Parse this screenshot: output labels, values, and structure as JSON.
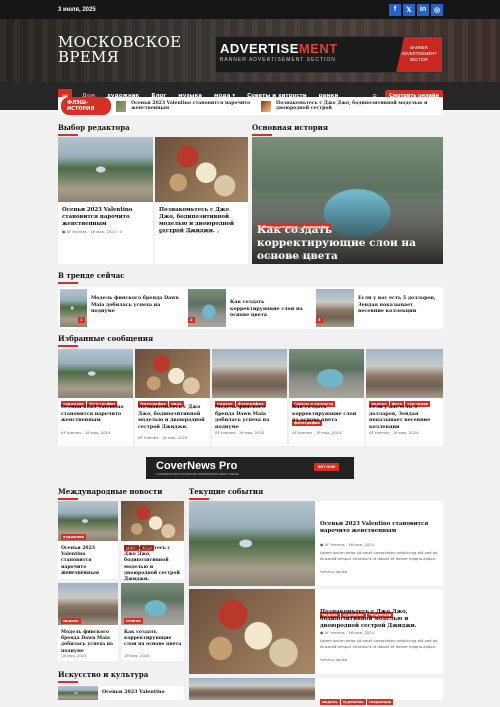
{
  "topbar": {
    "date": "3 июля, 2025",
    "social": [
      "f",
      "𝕏",
      "in",
      "◎"
    ]
  },
  "site": {
    "logo_line1": "МОСКОВСКОЕ",
    "logo_line2": "ВРЕМЯ"
  },
  "banner": {
    "ad_prefix": "ADVERTISE",
    "ad_suffix": "MENT",
    "sub": "BANNER ADVERTISEMENT SECTION",
    "tag_line1": "BANNER",
    "tag_line2": "ADVERTISEMENT",
    "tag_line3": "SECTION"
  },
  "nav": {
    "home_icon": "≡",
    "items": [
      "Дом",
      "художник",
      "Блог",
      "музыка",
      "мода",
      "Советы и хитрости",
      "рамки"
    ],
    "search_icon": "⌕",
    "watch": "Смотреть онлайн",
    "mode_chevron": "▾"
  },
  "ticker": {
    "label": "ФЛЭШ-ИСТОРИЯ",
    "item1": "Осеньи 2023 Valentino становится нарочито женственным",
    "item2": "Познакомьтесь с Джо Джо, бодипозитивной моделью и двоюродной сестрой"
  },
  "editor": {
    "title": "Выбор редактора",
    "c1": {
      "title": "Осеньи 2023 Valentino становится нарочито женственным",
      "author": "AF themes",
      "date": "16 мая, 2024",
      "comments": "0"
    },
    "c2": {
      "title": "Познакомьтесь с Джо Джо, бодипозитивной моделью и двоюродной сестрой Джиджи.",
      "author": "AF themes",
      "date": "16 мая, 2024",
      "comments": "0"
    }
  },
  "main_story": {
    "title": "Основная история",
    "badge1": "Советы и хитрости",
    "badge2": "фотография",
    "headline": "Как создать корректирующие слои на основе цвета",
    "author": "AF themes",
    "date": "16 мая, 2024",
    "comments": "0"
  },
  "trending": {
    "title": "В тренде сейчас",
    "items": [
      {
        "num": "1",
        "text": "Модель финского бренда Dawn Maia добилась успеха на подиуме"
      },
      {
        "num": "2",
        "text": "Как создать корректирующие слои на основе цвета"
      },
      {
        "num": "3",
        "text": "Если у вас есть 5 долларов, Зендая показывает весенние коллекции"
      }
    ]
  },
  "featured": {
    "title": "Избранные сообщения",
    "items": [
      {
        "badges": [
          "художник",
          "фотография"
        ],
        "text": "Осеньи 2023 Valentino становится нарочито женственным",
        "author": "AF themes",
        "date": "16 мая, 2024"
      },
      {
        "badges": [
          "фотография",
          "мода"
        ],
        "text": "Познакомьтесь с Джо Джо, бодипозитивной моделью и двоюродной сестрой Джиджи.",
        "author": "AF themes",
        "date": "16 мая, 2024"
      },
      {
        "badges": [
          "модель",
          "фотография"
        ],
        "text": "Модель финского бренда Dawn Maia добилась успеха на подиуме",
        "author": "AF themes",
        "date": "16 мая, 2024"
      },
      {
        "badges": [
          "Советы и хитрости",
          "фотография"
        ],
        "text": "Как создать корректирующие слои на основе цвета",
        "author": "AF themes",
        "date": "16 мая, 2024"
      },
      {
        "badges": [
          "модель",
          "фото",
          "художник"
        ],
        "text": "Если у вас есть 5 долларов, Зендая показывает весенние коллекции",
        "author": "AF themes",
        "date": "16 мая, 2024"
      }
    ]
  },
  "ad": {
    "brand": "CoverNews Pro",
    "sub": "A PREMIUM MULTIPURPOSE WORDPRESS NEWS THEME",
    "buy": "BUY NOW"
  },
  "international": {
    "title": "Международные новости",
    "items": [
      {
        "badges": [
          "художник"
        ],
        "text": "Осеньи 2023 Valentino становится нарочито женственным",
        "date": "16 мая, 2024"
      },
      {
        "badges": [
          "фото",
          "мода"
        ],
        "text": "Познакомьтесь с Джо Джо, бодипозитивной моделью и двоюродной сестрой Джиджи.",
        "date": "16 мая, 2024"
      },
      {
        "badges": [
          "модель"
        ],
        "text": "Модель финского бренда Dawn Maia добилась успеха на подиуме",
        "date": "16 мая, 2024"
      },
      {
        "badges": [
          "советы"
        ],
        "text": "Как создать корректирующие слои на основе цвета",
        "date": "16 мая, 2024"
      }
    ]
  },
  "arts": {
    "title": "Искусство и культура",
    "item": "Осеньи 2023 Valentino"
  },
  "current": {
    "title": "Текущие события",
    "items": [
      {
        "badges": [],
        "text": "Осеньи 2023 Valentino становится нарочито женственным",
        "author": "AF themes",
        "date": "16 мая, 2024",
        "excerpt": "Lorem ipsum dolor sit amet consectetur adipiscing elit sed do eiusmod tempor incididunt ut labore et dolore magna aliqua.",
        "more": "Читать далее"
      },
      {
        "badges": [
          "модель",
          "художник",
          "тенденции"
        ],
        "text": "Познакомьтесь с Джо Джо, бодипозитивной моделью и двоюродной сестрой Джиджи.",
        "author": "AF themes",
        "date": "16 мая, 2024",
        "excerpt": "Lorem ipsum dolor sit amet consectetur adipiscing elit sed do eiusmod tempor incididunt ut labore et dolore magna aliqua.",
        "more": "Читать далее"
      },
      {
        "badges": [
          "модель",
          "художник",
          "тенденции"
        ],
        "text": "",
        "author": "",
        "date": "",
        "excerpt": "",
        "more": ""
      }
    ]
  }
}
